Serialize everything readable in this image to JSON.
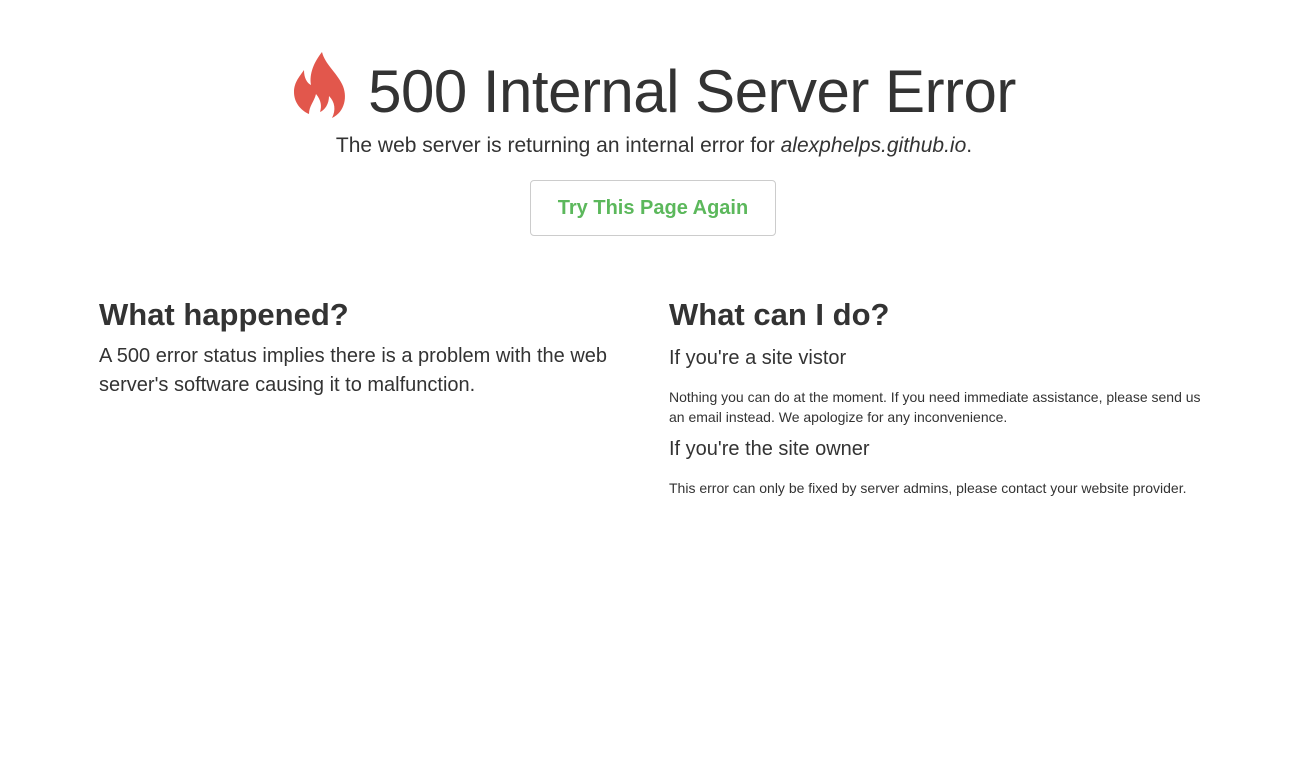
{
  "header": {
    "icon": "fire-icon",
    "icon_color": "#e2574c",
    "title": "500 Internal Server Error",
    "subtitle_prefix": "The web server is returning an internal error for ",
    "subtitle_domain": "alexphelps.github.io",
    "subtitle_suffix": ".",
    "retry_label": "Try This Page Again",
    "retry_color": "#5cb85c"
  },
  "left": {
    "heading": "What happened?",
    "text": "A 500 error status implies there is a problem with the web server's software causing it to malfunction."
  },
  "right": {
    "heading": "What can I do?",
    "visitor_heading": "If you're a site vistor",
    "visitor_text": "Nothing you can do at the moment. If you need immediate assistance, please send us an email instead. We apologize for any inconvenience.",
    "owner_heading": "If you're the site owner",
    "owner_text": "This error can only be fixed by server admins, please contact your website provider."
  }
}
